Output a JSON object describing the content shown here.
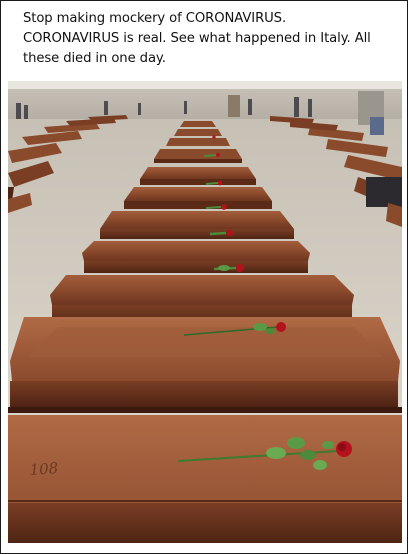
{
  "caption": {
    "line1": "Stop making mockery of CORONAVIRUS.",
    "line2": "CORONAVIRUS is real. See what happened in Italy. All",
    "line3": "these died in one day."
  },
  "photo": {
    "description_icon": "coffins-in-hangar-photo",
    "coffin_number_marking": "108"
  },
  "colors": {
    "coffin_wood": "#8a4a2c",
    "rose_red": "#b3121c",
    "leaf_green": "#4d8a3a",
    "floor": "#d9d2c7"
  }
}
